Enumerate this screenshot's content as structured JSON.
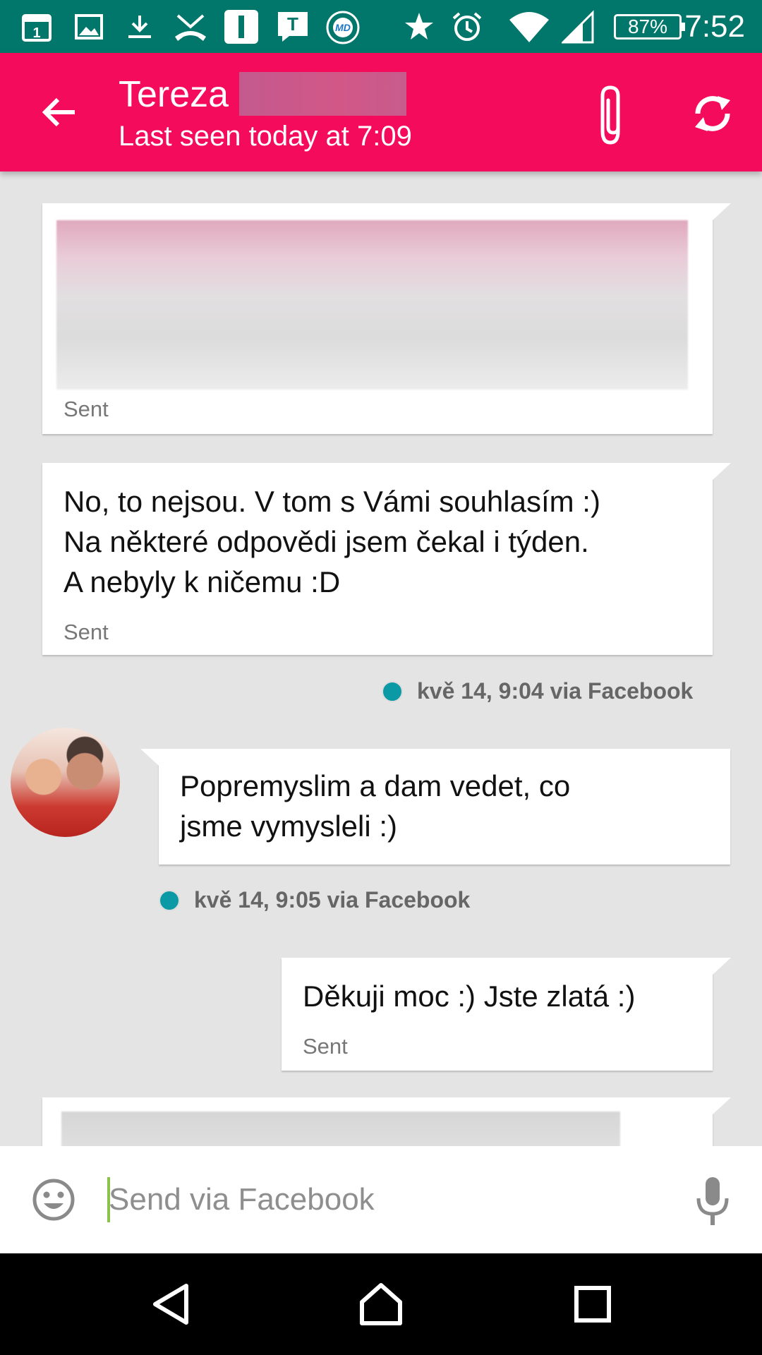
{
  "status_bar": {
    "battery": "87%",
    "time": "7:52",
    "calendar_day": "1",
    "badge_letter": "T",
    "md_label": "MD"
  },
  "header": {
    "contact_name": "Tereza",
    "last_seen": "Last seen today at 7:09",
    "color": "#f50b5b"
  },
  "messages": [
    {
      "direction": "out",
      "kind": "image",
      "status": "Sent"
    },
    {
      "direction": "out",
      "text": "No, to nejsou. V tom s Vámi souhlasím :)\nNa některé odpovědi jsem čekal i týden.\nA nebyly k ničemu :D",
      "status": "Sent"
    },
    {
      "direction": "out",
      "meta": "kvě 14, 9:04 via Facebook"
    },
    {
      "direction": "in",
      "text": "Popremyslim a dam vedet, co\njsme vymysleli :)",
      "meta": "kvě 14, 9:05 via Facebook"
    },
    {
      "direction": "out",
      "text": "Děkuji moc :) Jste zlatá :)",
      "status": "Sent"
    },
    {
      "direction": "out",
      "kind": "image"
    }
  ],
  "composer": {
    "placeholder": "Send via Facebook"
  },
  "colors": {
    "status_bar": "#00776a",
    "accent": "#f50b5b",
    "meta_dot": "#0b9aa5",
    "caret": "#8bc34a"
  }
}
